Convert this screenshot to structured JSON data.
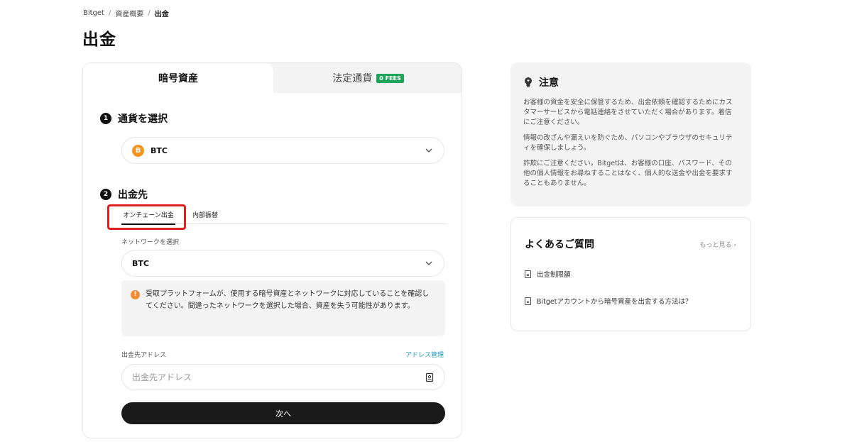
{
  "breadcrumb": {
    "items": [
      "Bitget",
      "資産概要",
      "出金"
    ],
    "separator": "/"
  },
  "page": {
    "title": "出金"
  },
  "tabs": {
    "crypto": "暗号資産",
    "fiat": "法定通貨",
    "fiat_badge": "0 FEES"
  },
  "step1": {
    "number": "1",
    "title": "通貨を選択"
  },
  "currency_select": {
    "icon": "B",
    "value": "BTC"
  },
  "step2": {
    "number": "2",
    "title": "出金先"
  },
  "subtabs": {
    "onchain": "オンチェーン出金",
    "internal": "内部振替"
  },
  "network": {
    "label": "ネットワークを選択",
    "value": "BTC"
  },
  "warning": {
    "icon": "!",
    "text": "受取プラットフォームが、使用する暗号資産とネットワークに対応していることを確認してください。間違ったネットワークを選択した場合、資産を失う可能性があります。"
  },
  "address": {
    "label": "出金先アドレス",
    "manage_link": "アドレス管理",
    "placeholder": "出金先アドレス"
  },
  "next_button": "次へ",
  "notice": {
    "title": "注意",
    "paragraphs": [
      "お客様の資金を安全に保管するため、出金依頼を確認するためにカスタマーサービスから電話連絡をさせていただく場合があります。着信にご注意ください。",
      "情報の改ざんや漏えいを防ぐため、パソコンやブラウザのセキュリティを確保しましょう。",
      "詐欺にご注意ください。Bitgetは、お客様の口座、パスワード、その他の個人情報をお尋ねすることはなく、個人的な送金や出金を要求することもありません。"
    ]
  },
  "faq": {
    "title": "よくあるご質問",
    "more": "もっと見る",
    "items": [
      "出金制限額",
      "Bitgetアカウントから暗号資産を出金する方法は？"
    ]
  },
  "colors": {
    "accent_green": "#1fa45a",
    "btc_orange": "#f7931a",
    "warning_orange": "#f08c33",
    "link_blue": "#1b9bc5",
    "highlight_red": "#e02020"
  },
  "icons": {
    "notice": "lightbulb-icon",
    "chevron": "chevron-down-icon",
    "address_book": "address-book-icon",
    "faq_item": "document-icon",
    "more": "chevron-right-icon"
  }
}
